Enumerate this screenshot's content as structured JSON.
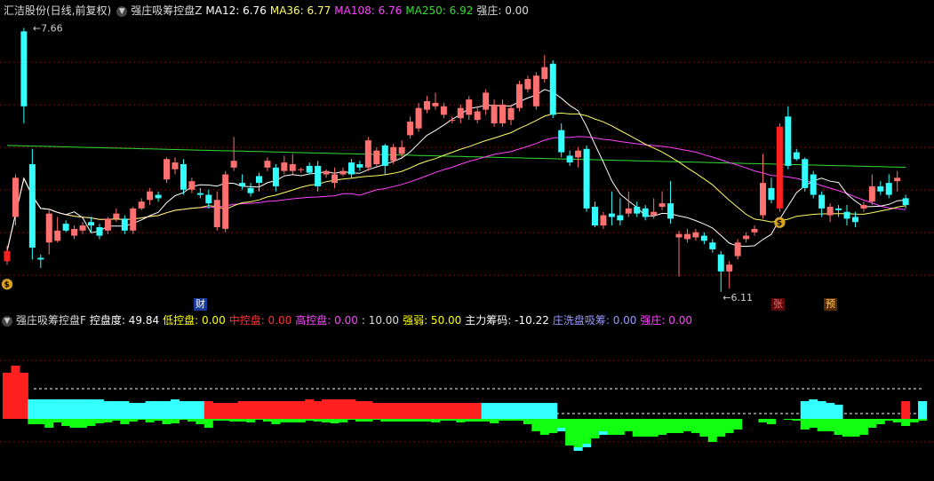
{
  "top_header": {
    "stock_title": "汇洁股份(日线,前复权)",
    "indicator_name": "强庄吸筹控盘Z",
    "items": [
      {
        "label": "MA12: 6.76",
        "color": "#ffffff"
      },
      {
        "label": "MA36: 6.77",
        "color": "#ffff66"
      },
      {
        "label": "MA108: 6.76",
        "color": "#ff44ff"
      },
      {
        "label": "MA250: 6.92",
        "color": "#33dd33"
      },
      {
        "label": "强庄: 0.00",
        "color": "#dddddd"
      }
    ]
  },
  "bottom_header": {
    "indicator_name": "强庄吸筹控盘F",
    "items": [
      {
        "label": "控盘度: 49.84",
        "color": "#ffffff"
      },
      {
        "label": "低控盘: 0.00",
        "color": "#ffff00"
      },
      {
        "label": "中控盘: 0.00",
        "color": "#ff3333"
      },
      {
        "label": "高控盘: 0.00",
        "color": "#ff44ff"
      },
      {
        "label": ": 10.00",
        "color": "#dddddd"
      },
      {
        "label": "强弱: 50.00",
        "color": "#ffff00"
      },
      {
        "label": "主力筹码: -10.22",
        "color": "#ffffff"
      },
      {
        "label": "庄洗盘吸筹: 0.00",
        "color": "#9999ff"
      },
      {
        "label": "强庄: 0.00",
        "color": "#ff44ff"
      }
    ]
  },
  "annotations": {
    "high_label": "7.66",
    "low_label": "6.11",
    "event_cai": "财",
    "event_zhang": "张",
    "event_yu": "预"
  },
  "colors": {
    "up": "#ff7070",
    "up_solid": "#ff2020",
    "down": "#33ffff",
    "ma12": "#ffffff",
    "ma36": "#ffff66",
    "ma108": "#ff44ff",
    "ma250": "#33dd33",
    "grid": "#8b0000"
  },
  "chart_data": {
    "type": "candlestick",
    "high": 7.66,
    "low": 6.11,
    "ylim": [
      6.0,
      7.72
    ],
    "candles": [
      [
        6.29,
        6.35,
        6.27,
        6.38
      ],
      [
        6.55,
        6.78,
        6.5,
        6.8
      ],
      [
        7.64,
        7.2,
        7.1,
        7.66
      ],
      [
        6.86,
        6.37,
        6.3,
        6.95
      ],
      [
        6.31,
        6.3,
        6.25,
        6.33
      ],
      [
        6.4,
        6.57,
        6.33,
        6.6
      ],
      [
        6.41,
        6.47,
        6.4,
        6.55
      ],
      [
        6.51,
        6.47,
        6.46,
        6.53
      ],
      [
        6.44,
        6.48,
        6.42,
        6.5
      ],
      [
        6.47,
        6.5,
        6.45,
        6.52
      ],
      [
        6.52,
        6.5,
        6.46,
        6.55
      ],
      [
        6.49,
        6.44,
        6.42,
        6.51
      ],
      [
        6.47,
        6.54,
        6.45,
        6.55
      ],
      [
        6.54,
        6.57,
        6.52,
        6.6
      ],
      [
        6.54,
        6.47,
        6.45,
        6.56
      ],
      [
        6.47,
        6.6,
        6.45,
        6.61
      ],
      [
        6.6,
        6.64,
        6.59,
        6.66
      ],
      [
        6.65,
        6.7,
        6.62,
        6.72
      ],
      [
        6.68,
        6.66,
        6.64,
        6.7
      ],
      [
        6.77,
        6.89,
        6.75,
        6.9
      ],
      [
        6.83,
        6.87,
        6.8,
        6.9
      ],
      [
        6.86,
        6.71,
        6.68,
        6.89
      ],
      [
        6.71,
        6.76,
        6.69,
        6.78
      ],
      [
        6.69,
        6.68,
        6.66,
        6.72
      ],
      [
        6.68,
        6.63,
        6.6,
        6.71
      ],
      [
        6.49,
        6.65,
        6.47,
        6.7
      ],
      [
        6.48,
        6.8,
        6.46,
        6.82
      ],
      [
        6.84,
        6.88,
        6.82,
        7.02
      ],
      [
        6.75,
        6.73,
        6.71,
        6.8
      ],
      [
        6.72,
        6.69,
        6.67,
        6.75
      ],
      [
        6.79,
        6.75,
        6.7,
        6.81
      ],
      [
        6.84,
        6.88,
        6.82,
        6.9
      ],
      [
        6.84,
        6.73,
        6.7,
        6.86
      ],
      [
        6.82,
        6.87,
        6.8,
        6.91
      ],
      [
        6.82,
        6.86,
        6.8,
        6.92
      ],
      [
        6.83,
        6.83,
        6.81,
        6.84
      ],
      [
        6.85,
        6.81,
        6.8,
        6.87
      ],
      [
        6.85,
        6.73,
        6.7,
        6.88
      ],
      [
        6.8,
        6.82,
        6.78,
        6.83
      ],
      [
        6.75,
        6.8,
        6.72,
        6.84
      ],
      [
        6.8,
        6.82,
        6.79,
        6.84
      ],
      [
        6.87,
        6.8,
        6.78,
        6.89
      ],
      [
        6.86,
        6.84,
        6.82,
        6.88
      ],
      [
        6.84,
        7.0,
        6.82,
        7.02
      ],
      [
        6.86,
        6.94,
        6.84,
        6.96
      ],
      [
        6.97,
        6.85,
        6.8,
        6.98
      ],
      [
        6.88,
        6.96,
        6.86,
        6.98
      ],
      [
        6.92,
        6.96,
        6.9,
        7.0
      ],
      [
        7.03,
        7.11,
        7.01,
        7.14
      ],
      [
        7.07,
        7.19,
        7.05,
        7.22
      ],
      [
        7.18,
        7.23,
        7.16,
        7.26
      ],
      [
        7.2,
        7.22,
        7.18,
        7.28
      ],
      [
        7.15,
        7.2,
        7.13,
        7.22
      ],
      [
        7.12,
        7.12,
        7.1,
        7.14
      ],
      [
        7.13,
        7.19,
        7.1,
        7.21
      ],
      [
        7.15,
        7.24,
        7.12,
        7.26
      ],
      [
        7.12,
        7.17,
        7.1,
        7.2
      ],
      [
        7.18,
        7.28,
        7.15,
        7.3
      ],
      [
        7.1,
        7.21,
        7.08,
        7.24
      ],
      [
        7.1,
        7.21,
        7.08,
        7.24
      ],
      [
        7.12,
        7.19,
        7.09,
        7.21
      ],
      [
        7.19,
        7.33,
        7.17,
        7.35
      ],
      [
        7.3,
        7.36,
        7.28,
        7.38
      ],
      [
        7.2,
        7.38,
        7.18,
        7.4
      ],
      [
        7.36,
        7.43,
        7.34,
        7.5
      ],
      [
        7.45,
        7.15,
        7.13,
        7.47
      ],
      [
        7.06,
        6.93,
        6.9,
        7.1
      ],
      [
        6.91,
        6.87,
        6.85,
        6.94
      ],
      [
        6.9,
        6.94,
        6.84,
        6.96
      ],
      [
        6.95,
        6.6,
        6.58,
        6.97
      ],
      [
        6.61,
        6.5,
        6.49,
        6.64
      ],
      [
        6.5,
        6.56,
        6.48,
        6.58
      ],
      [
        6.57,
        6.55,
        6.5,
        6.7
      ],
      [
        6.56,
        6.53,
        6.5,
        6.66
      ],
      [
        6.57,
        6.6,
        6.55,
        6.7
      ],
      [
        6.61,
        6.57,
        6.55,
        6.64
      ],
      [
        6.6,
        6.55,
        6.53,
        6.62
      ],
      [
        6.56,
        6.58,
        6.54,
        6.66
      ],
      [
        6.61,
        6.63,
        6.59,
        6.7
      ],
      [
        6.63,
        6.54,
        6.51,
        6.76
      ],
      [
        6.43,
        6.45,
        6.2,
        6.47
      ],
      [
        6.42,
        6.45,
        6.4,
        6.48
      ],
      [
        6.43,
        6.46,
        6.41,
        6.48
      ],
      [
        6.44,
        6.41,
        6.39,
        6.46
      ],
      [
        6.4,
        6.36,
        6.34,
        6.42
      ],
      [
        6.33,
        6.23,
        6.11,
        6.35
      ],
      [
        6.23,
        6.27,
        6.13,
        6.29
      ],
      [
        6.32,
        6.4,
        6.3,
        6.42
      ],
      [
        6.42,
        6.44,
        6.4,
        6.46
      ],
      [
        6.46,
        6.48,
        6.44,
        6.5
      ],
      [
        6.56,
        6.75,
        6.54,
        6.92
      ],
      [
        6.72,
        6.65,
        6.63,
        6.78
      ],
      [
        6.6,
        7.08,
        6.58,
        7.1
      ],
      [
        7.14,
        6.85,
        6.83,
        7.2
      ],
      [
        6.93,
        6.89,
        6.88,
        6.95
      ],
      [
        6.89,
        6.72,
        6.7,
        6.9
      ],
      [
        6.8,
        6.68,
        6.66,
        6.82
      ],
      [
        6.68,
        6.6,
        6.55,
        6.7
      ],
      [
        6.56,
        6.61,
        6.52,
        6.63
      ],
      [
        6.6,
        6.59,
        6.55,
        6.62
      ],
      [
        6.58,
        6.54,
        6.5,
        6.62
      ],
      [
        6.55,
        6.52,
        6.49,
        6.58
      ],
      [
        6.6,
        6.62,
        6.58,
        6.64
      ],
      [
        6.64,
        6.73,
        6.62,
        6.8
      ],
      [
        6.73,
        6.7,
        6.68,
        6.76
      ],
      [
        6.75,
        6.68,
        6.66,
        6.8
      ],
      [
        6.76,
        6.78,
        6.7,
        6.82
      ],
      [
        6.66,
        6.62,
        6.6,
        6.68
      ]
    ],
    "indicator_bars": [
      [
        52,
        0
      ],
      [
        60,
        0
      ],
      [
        52,
        0
      ],
      [
        22,
        -6
      ],
      [
        22,
        -6
      ],
      [
        22,
        -10
      ],
      [
        22,
        -4
      ],
      [
        22,
        -8
      ],
      [
        22,
        -10
      ],
      [
        22,
        -10
      ],
      [
        22,
        -8
      ],
      [
        22,
        -5
      ],
      [
        20,
        -4
      ],
      [
        20,
        -2
      ],
      [
        20,
        -6
      ],
      [
        18,
        -3
      ],
      [
        18,
        -1
      ],
      [
        20,
        -4
      ],
      [
        20,
        -2
      ],
      [
        20,
        -6
      ],
      [
        22,
        -5
      ],
      [
        20,
        -1
      ],
      [
        20,
        -3
      ],
      [
        20,
        -6
      ],
      [
        20,
        -10
      ],
      [
        18,
        -2
      ],
      [
        18,
        -2
      ],
      [
        18,
        -3
      ],
      [
        20,
        -3
      ],
      [
        20,
        -4
      ],
      [
        20,
        -1
      ],
      [
        20,
        -3
      ],
      [
        20,
        -6
      ],
      [
        20,
        -4
      ],
      [
        20,
        -4
      ],
      [
        20,
        -4
      ],
      [
        22,
        -2
      ],
      [
        20,
        -3
      ],
      [
        22,
        -4
      ],
      [
        22,
        -5
      ],
      [
        22,
        -4
      ],
      [
        22,
        -1
      ],
      [
        20,
        -3
      ],
      [
        20,
        -3
      ],
      [
        18,
        -1
      ],
      [
        18,
        -3
      ],
      [
        18,
        -3
      ],
      [
        18,
        -3
      ],
      [
        18,
        -3
      ],
      [
        18,
        -3
      ],
      [
        18,
        -3
      ],
      [
        18,
        -4
      ],
      [
        18,
        -2
      ],
      [
        18,
        -2
      ],
      [
        18,
        -4
      ],
      [
        18,
        -3
      ],
      [
        18,
        -3
      ],
      [
        18,
        -3
      ],
      [
        18,
        -5
      ],
      [
        18,
        -2
      ],
      [
        18,
        -2
      ],
      [
        18,
        -2
      ],
      [
        18,
        -6
      ],
      [
        18,
        -14
      ],
      [
        18,
        -18
      ],
      [
        18,
        -16
      ],
      [
        0,
        -14
      ],
      [
        0,
        -30
      ],
      [
        0,
        -36
      ],
      [
        0,
        -32
      ],
      [
        0,
        -22
      ],
      [
        0,
        -18
      ],
      [
        0,
        -18
      ],
      [
        0,
        -18
      ],
      [
        0,
        -14
      ],
      [
        0,
        -20
      ],
      [
        0,
        -20
      ],
      [
        0,
        -20
      ],
      [
        0,
        -18
      ],
      [
        0,
        -16
      ],
      [
        0,
        -16
      ],
      [
        0,
        -14
      ],
      [
        0,
        -16
      ],
      [
        0,
        -20
      ],
      [
        0,
        -26
      ],
      [
        0,
        -20
      ],
      [
        0,
        -16
      ],
      [
        0,
        -12
      ],
      [
        0,
        4
      ],
      [
        0,
        10
      ],
      [
        0,
        -4
      ],
      [
        0,
        -6
      ],
      [
        0,
        44
      ],
      [
        0,
        -1
      ],
      [
        0,
        -2
      ],
      [
        20,
        -12
      ],
      [
        22,
        -10
      ],
      [
        20,
        -14
      ],
      [
        18,
        -14
      ],
      [
        16,
        -18
      ],
      [
        0,
        -20
      ],
      [
        0,
        -20
      ],
      [
        0,
        -18
      ],
      [
        0,
        -10
      ],
      [
        0,
        -6
      ],
      [
        0,
        -2
      ],
      [
        0,
        -4
      ],
      [
        20,
        -8
      ],
      [
        0,
        -4
      ],
      [
        20,
        -2
      ]
    ]
  }
}
